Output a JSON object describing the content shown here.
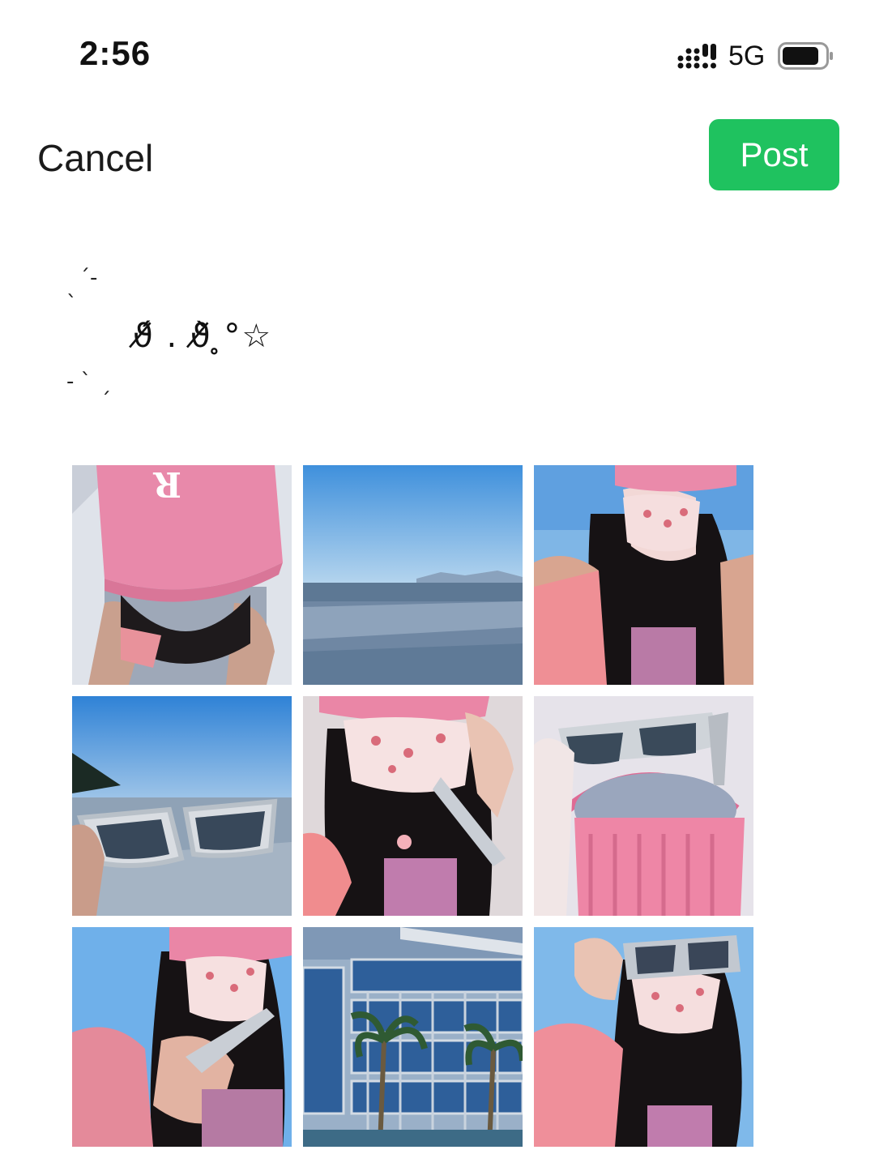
{
  "status_bar": {
    "time": "2:56",
    "network": "5G",
    "icons": [
      "signal-icon",
      "battery-icon"
    ]
  },
  "nav": {
    "cancel_label": "Cancel",
    "post_label": "Post",
    "post_color": "#1fc25f"
  },
  "caption": {
    "line1": "´-",
    "line2": "`",
    "main": "ϑ̸́ . ϑ̸̀ ̥°☆",
    "line4": "- `",
    "line5": "´"
  },
  "photos": [
    {
      "subject": "pink cap with letter R, top-down selfie on sand"
    },
    {
      "subject": "beach shoreline under blue sky"
    },
    {
      "subject": "selfie with pink cap and patterned mask"
    },
    {
      "subject": "hand holding clear sunglasses against beach sky"
    },
    {
      "subject": "selfie with mask holding sunglasses"
    },
    {
      "subject": "sunglasses hanging over pink ruched bag"
    },
    {
      "subject": "selfie with pink cap holding sunglasses"
    },
    {
      "subject": "glass building with palm trees"
    },
    {
      "subject": "selfie wearing sunglasses and mask"
    }
  ]
}
